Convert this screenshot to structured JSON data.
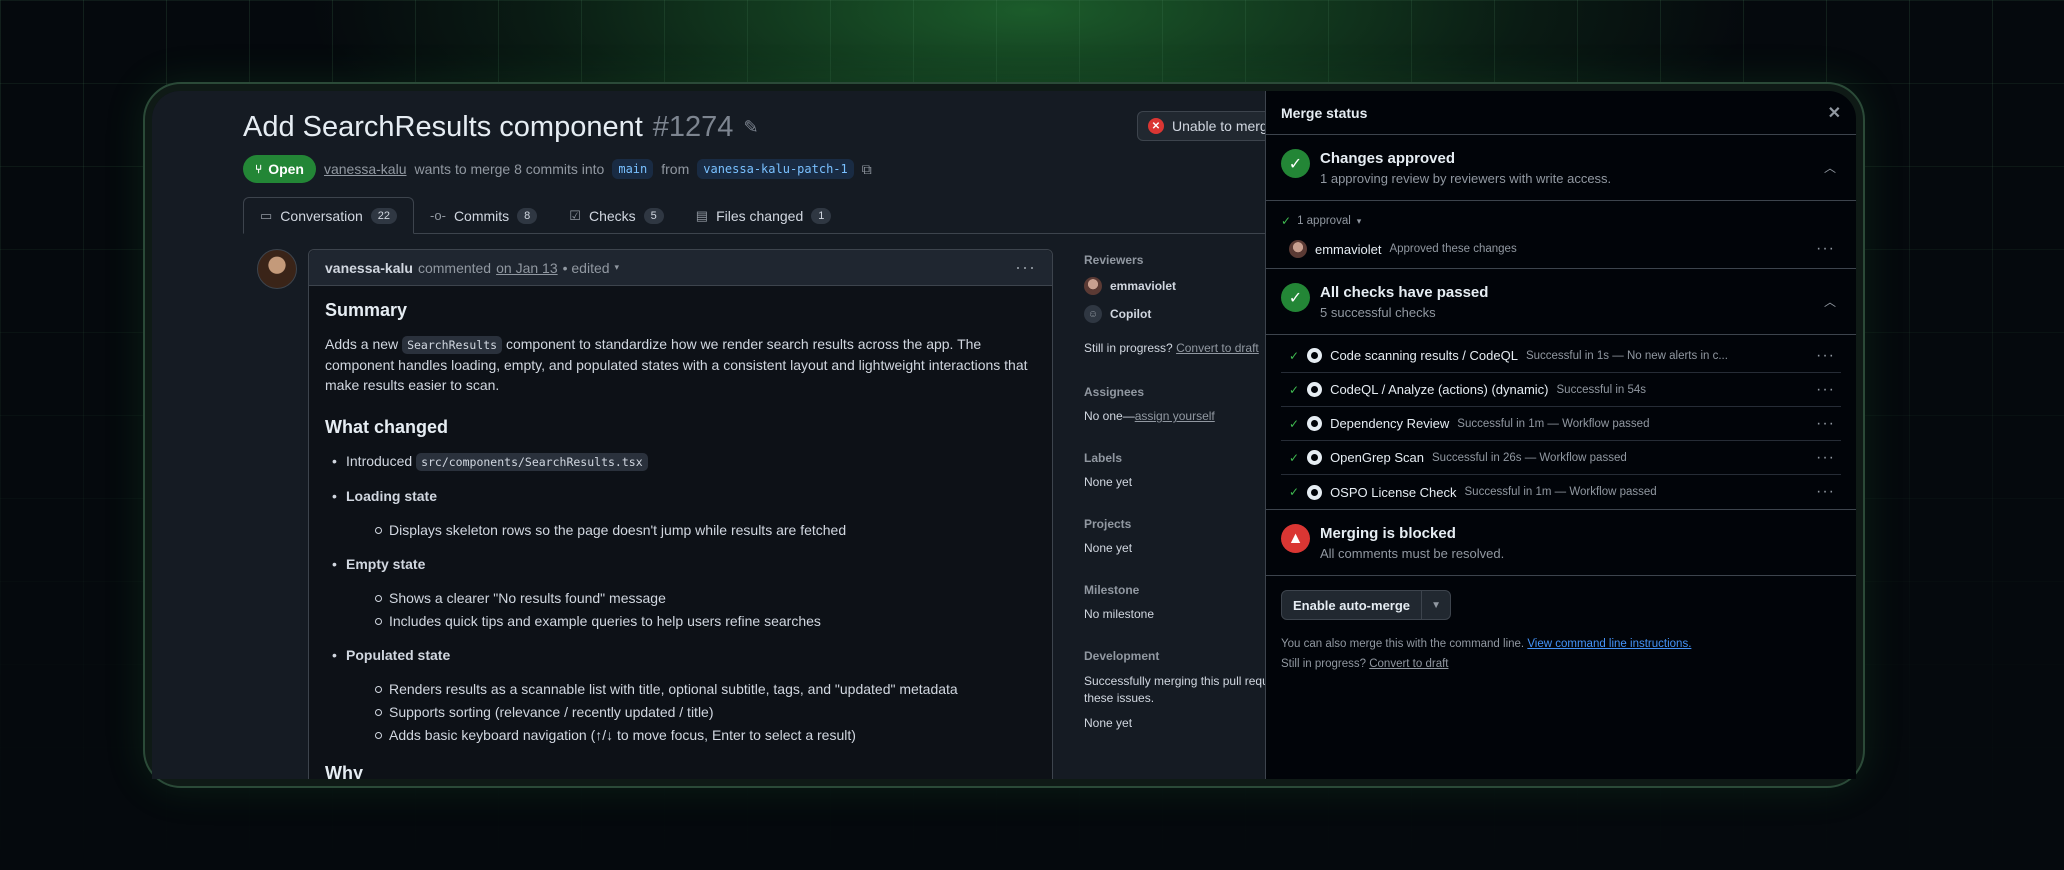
{
  "pr": {
    "title": "Add SearchResults component",
    "number": "#1274",
    "status": "Open",
    "author": "vanessa-kalu",
    "merge_text": "wants to merge 8 commits into",
    "base_branch": "main",
    "from_text": "from",
    "head_branch": "vanessa-kalu-patch-1",
    "unable_button": "Unable to merg"
  },
  "tabs": [
    {
      "label": "Conversation",
      "count": "22"
    },
    {
      "label": "Commits",
      "count": "8"
    },
    {
      "label": "Checks",
      "count": "5"
    },
    {
      "label": "Files changed",
      "count": "1"
    }
  ],
  "comment": {
    "author": "vanessa-kalu",
    "action": "commented",
    "date": "on Jan 13",
    "edited": "• edited",
    "summary_heading": "Summary",
    "summary_pre": "Adds a new",
    "summary_code": "SearchResults",
    "summary_post": "component to standardize how we render search results across the app. The component handles loading, empty, and populated states with a consistent layout and lightweight interactions that make results easier to scan.",
    "changed_heading": "What changed",
    "introduced_label": "Introduced",
    "introduced_code": "src/components/SearchResults.tsx",
    "loading_label": "Loading state",
    "loading_items": [
      "Displays skeleton rows so the page doesn't jump while results are fetched"
    ],
    "empty_label": "Empty state",
    "empty_items": [
      "Shows a clearer \"No results found\" message",
      "Includes quick tips and example queries to help users refine searches"
    ],
    "populated_label": "Populated state",
    "populated_items": [
      "Renders results as a scannable list with title, optional subtitle, tags, and \"updated\" metadata",
      "Supports sorting (relevance / recently updated / title)",
      "Adds basic keyboard navigation (↑/↓ to move focus, Enter to select a result)"
    ],
    "why_heading": "Why"
  },
  "sidebar": {
    "reviewers_heading": "Reviewers",
    "reviewers": [
      "emmaviolet",
      "Copilot"
    ],
    "still_in_progress": "Still in progress?",
    "convert_to_draft": "Convert to draft",
    "assignees_heading": "Assignees",
    "assignees_none": "No one—",
    "assign_yourself": "assign yourself",
    "labels_heading": "Labels",
    "labels_value": "None yet",
    "projects_heading": "Projects",
    "projects_value": "None yet",
    "milestone_heading": "Milestone",
    "milestone_value": "No milestone",
    "development_heading": "Development",
    "development_text_1": "Successfully merging this pull requ",
    "development_text_2": "these issues.",
    "development_value": "None yet"
  },
  "merge_status": {
    "title": "Merge status",
    "approved_title": "Changes approved",
    "approved_sub": "1 approving review by reviewers with write access.",
    "approval_toggle": "1 approval",
    "approver": "emmaviolet",
    "approver_desc": "Approved these changes",
    "checks_title": "All checks have passed",
    "checks_sub": "5 successful checks",
    "checks": [
      {
        "name": "Code scanning results / CodeQL",
        "desc": "Successful in 1s — No new alerts in c..."
      },
      {
        "name": "CodeQL / Analyze (actions) (dynamic)",
        "desc": "Successful in 54s"
      },
      {
        "name": "Dependency Review",
        "desc": "Successful in 1m — Workflow passed"
      },
      {
        "name": "OpenGrep Scan",
        "desc": "Successful in 26s — Workflow passed"
      },
      {
        "name": "OSPO License Check",
        "desc": "Successful in 1m — Workflow passed"
      }
    ],
    "blocked_title": "Merging is blocked",
    "blocked_sub": "All comments must be resolved.",
    "auto_merge_label": "Enable auto-merge",
    "cli_text": "You can also merge this with the command line.",
    "cli_link": "View command line instructions.",
    "still_in_progress": "Still in progress?",
    "convert_to_draft": "Convert to draft"
  },
  "colors": {
    "accent_green": "#238636",
    "danger_red": "#da3633",
    "link_blue": "#4493f8"
  }
}
